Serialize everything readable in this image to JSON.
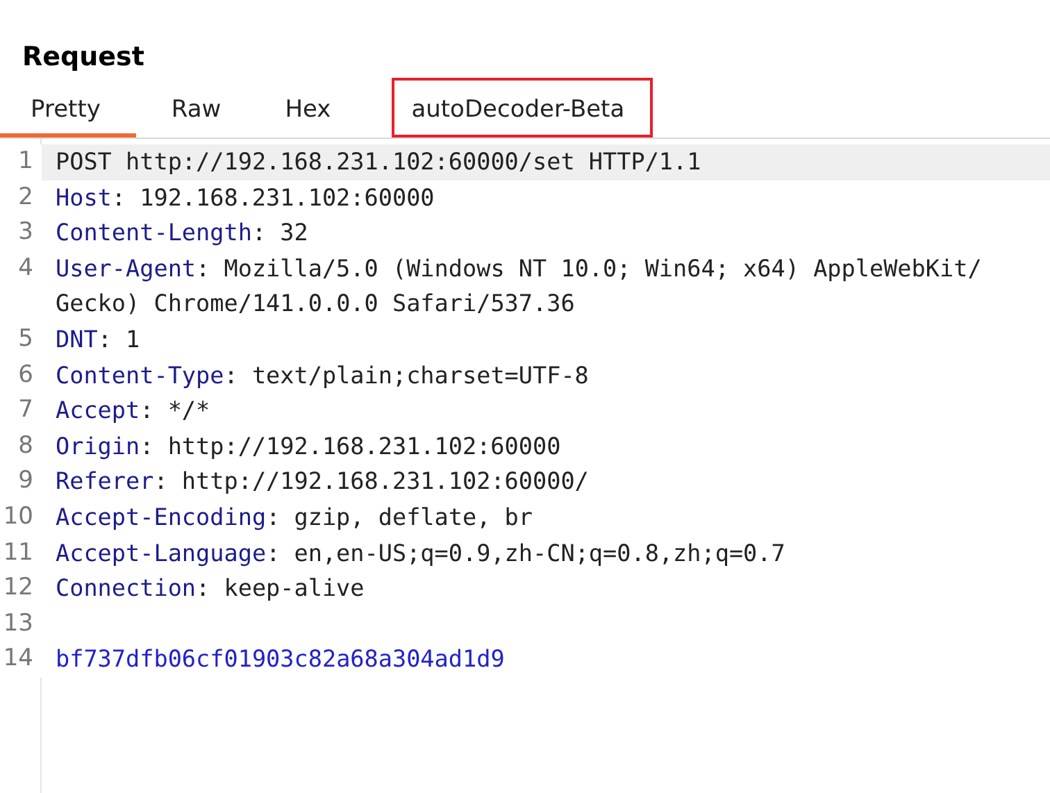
{
  "panel": {
    "title": "Request"
  },
  "tabs": [
    {
      "label": "Pretty",
      "selected": true,
      "highlighted": false
    },
    {
      "label": "Raw",
      "selected": false,
      "highlighted": false
    },
    {
      "label": "Hex",
      "selected": false,
      "highlighted": false
    },
    {
      "label": "autoDecoder-Beta",
      "selected": false,
      "highlighted": true
    }
  ],
  "editor": {
    "lines": [
      {
        "number": "1",
        "kind": "request_line",
        "selected": true,
        "text": "POST http://192.168.231.102:60000/set HTTP/1.1"
      },
      {
        "number": "2",
        "kind": "header",
        "selected": false,
        "name": "Host",
        "separator": ":",
        "value": "192.168.231.102:60000"
      },
      {
        "number": "3",
        "kind": "header",
        "selected": false,
        "name": "Content-Length",
        "separator": ":",
        "value": "32"
      },
      {
        "number": "4",
        "kind": "header",
        "selected": false,
        "name": "User-Agent",
        "separator": ":",
        "value": "Mozilla/5.0 (Windows NT 10.0; Win64; x64) AppleWebKit/",
        "continuation": "Gecko) Chrome/141.0.0.0 Safari/537.36"
      },
      {
        "number": "5",
        "kind": "header",
        "selected": false,
        "name": "DNT",
        "separator": ":",
        "value": "1"
      },
      {
        "number": "6",
        "kind": "header",
        "selected": false,
        "name": "Content-Type",
        "separator": ":",
        "value": "text/plain;charset=UTF-8"
      },
      {
        "number": "7",
        "kind": "header",
        "selected": false,
        "name": "Accept",
        "separator": ":",
        "value": "*/*"
      },
      {
        "number": "8",
        "kind": "header",
        "selected": false,
        "name": "Origin",
        "separator": ":",
        "value": "http://192.168.231.102:60000"
      },
      {
        "number": "9",
        "kind": "header",
        "selected": false,
        "name": "Referer",
        "separator": ":",
        "value": "http://192.168.231.102:60000/"
      },
      {
        "number": "10",
        "kind": "header",
        "selected": false,
        "name": "Accept-Encoding",
        "separator": ":",
        "value": "gzip, deflate, br"
      },
      {
        "number": "11",
        "kind": "header",
        "selected": false,
        "name": "Accept-Language",
        "separator": ":",
        "value": "en,en-US;q=0.9,zh-CN;q=0.8,zh;q=0.7"
      },
      {
        "number": "12",
        "kind": "header",
        "selected": false,
        "name": "Connection",
        "separator": ":",
        "value": "keep-alive"
      },
      {
        "number": "13",
        "kind": "blank",
        "selected": false
      },
      {
        "number": "14",
        "kind": "body",
        "selected": false,
        "text": "bf737dfb06cf01903c82a68a304ad1d9"
      }
    ]
  }
}
